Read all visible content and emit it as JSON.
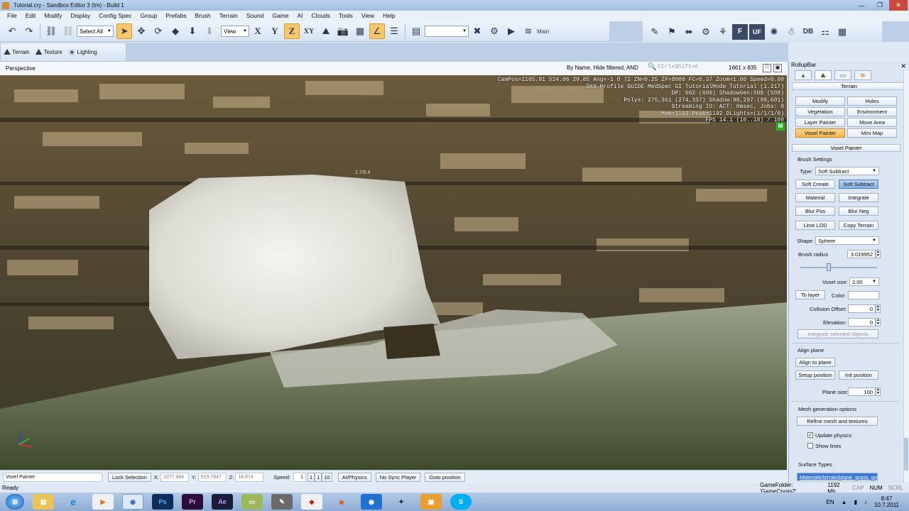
{
  "window": {
    "title": "Tutorial.cry - Sandbox Editor 3 (tm) - Build 1",
    "min": "—",
    "max": "❐",
    "close": "✕"
  },
  "menu": [
    "File",
    "Edit",
    "Modify",
    "Display",
    "Config Spec",
    "Group",
    "Prefabs",
    "Brush",
    "Terrain",
    "Sound",
    "Game",
    "AI",
    "Clouds",
    "Tools",
    "View",
    "Help"
  ],
  "toolbar": {
    "select_all": "Select All",
    "coord_view": "View",
    "axis_x": "X",
    "axis_y": "Y",
    "axis_z": "Z",
    "axis_xy": "XY",
    "main_label": "Main",
    "db_label": "DB",
    "f_label": "F",
    "uf_label": "UF"
  },
  "toolbar2": {
    "terrain": "Terrain",
    "texture": "Texture",
    "lighting": "Lighting"
  },
  "viewport": {
    "title": "Perspective",
    "filter": "By Name, Hide filtered, AND",
    "search_hint": "Ctrl+Shift+F",
    "resolution": "1661 x 835",
    "brush_label": "1.7/6.4",
    "hud": [
      "CamPos=1105.91 524.06 29.85 Ang=-1 0 72 ZN=0.25 ZF=8000 FC=0.37 Zoom=1.00 Speed=0.00",
      "DX9 Profile GUIDE MedSpec GI TutorialMode Tutorial (1.217)",
      "DP: 602 (600) ShadowGen:508 (508)",
      "Polys: 275,361 (274,337) Shadow:98,297 (98,601)",
      "Streaming IO: ACT: 0msec, Jobs: 0",
      "Mem=1192 Peak=1192 DLights=(1/1/1/0)",
      "FPS 14.1 (10..18) / 100"
    ],
    "m_badge": "M"
  },
  "status": {
    "mode": "Voxel Painter",
    "lock": "Lock Selection",
    "x_label": "X:",
    "x_val": "1077.984",
    "y_label": "Y:",
    "y_val": "519.7847",
    "z_label": "Z:",
    "z_val": "18.974",
    "speed_label": "Speed:",
    "speed_val": "1",
    "speed_opts": [
      "1",
      "1",
      "10"
    ],
    "ai_physics": "AI/Physics",
    "no_sync": "No Sync Player",
    "goto": "Goto position"
  },
  "readybar": {
    "ready": "Ready",
    "gamefolder": "GameFolder: 'GameCrysis2'",
    "mem": "1192 Mb",
    "cap": "CAP",
    "num": "NUM",
    "scrl": "SCRL"
  },
  "rollup": {
    "title": "RollupBar",
    "terrain_header": "Terrain",
    "terrain_buttons": [
      "Modify",
      "Holes",
      "Vegetation",
      "Environment",
      "Layer Painter",
      "Move Area",
      "Voxel Painter",
      "Mini Map"
    ],
    "voxel_header": "Voxel Painter",
    "brush_settings": "Brush Settings",
    "type_label": "Type:",
    "type_val": "Soft Subtract",
    "ops": [
      "Soft Create",
      "Soft Subtract",
      "Material",
      "Integrate",
      "Blur Pos",
      "Blur Neg",
      "Limit LOD",
      "Copy Terrain"
    ],
    "shape_label": "Shape:",
    "shape_val": "Sphere",
    "radius_label": "Brush radius",
    "radius_val": "3.019952",
    "voxel_size_label": "Voxel size:",
    "voxel_size_val": "2.00",
    "to_layer": "To layer",
    "color_label": "Color:",
    "collision_label": "Collision Offset:",
    "collision_val": "0",
    "elevation_label": "Elevation:",
    "elevation_val": "0",
    "integrate_sel": "Integrate selected objects",
    "align_plane_label": "Align plane",
    "align_to_plane": "Align to plane",
    "setup_position": "Setup position",
    "init_position": "Init position",
    "plane_size_label": "Plane size:",
    "plane_size_val": "100",
    "mesh_gen_label": "Mesh generation options",
    "refine": "Refine mesh and textures",
    "update_physics": "Update physics",
    "show_lines": "Show lines",
    "surface_types": "Surface Types",
    "surface_item": "Materials/terrain/plane_grass_gre"
  },
  "taskbar": {
    "lang": "EN",
    "time": "8:47",
    "date": "10.7.2011"
  },
  "colors": {
    "accent": "#f3b54d",
    "selected": "#84b1e3",
    "hud_text": "#ffffff",
    "m_badge": "#26b326"
  }
}
